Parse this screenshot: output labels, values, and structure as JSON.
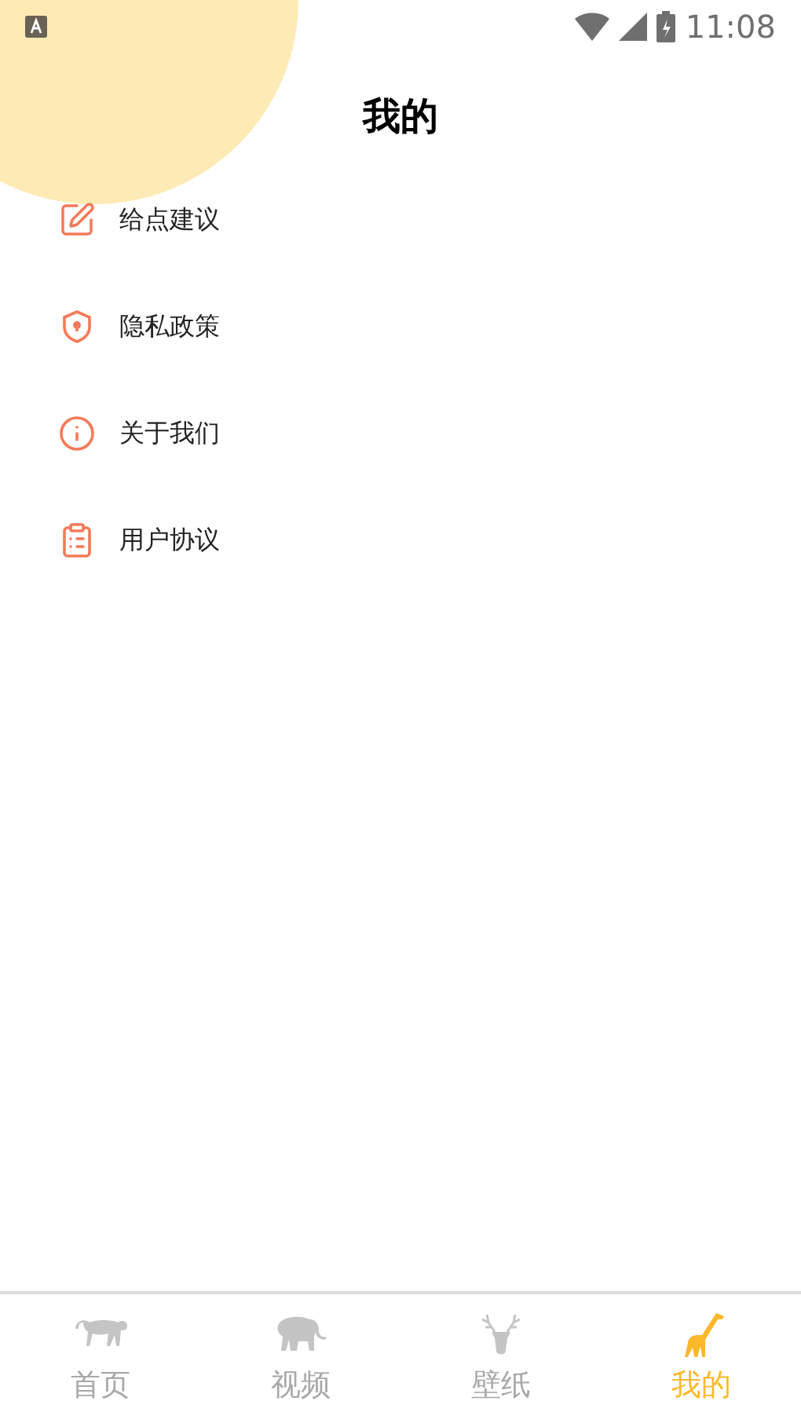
{
  "status_bar": {
    "time": "11:08"
  },
  "title": "我的",
  "menu": [
    {
      "kind": "feedback",
      "label": "给点建议"
    },
    {
      "kind": "privacy",
      "label": "隐私政策"
    },
    {
      "kind": "about",
      "label": "关于我们"
    },
    {
      "kind": "agreement",
      "label": "用户协议"
    }
  ],
  "tabs": [
    {
      "kind": "monkey",
      "label": "首页",
      "selected": false
    },
    {
      "kind": "elephant",
      "label": "视频",
      "selected": false
    },
    {
      "kind": "deer",
      "label": "壁纸",
      "selected": false
    },
    {
      "kind": "giraffe",
      "label": "我的",
      "selected": true
    }
  ]
}
